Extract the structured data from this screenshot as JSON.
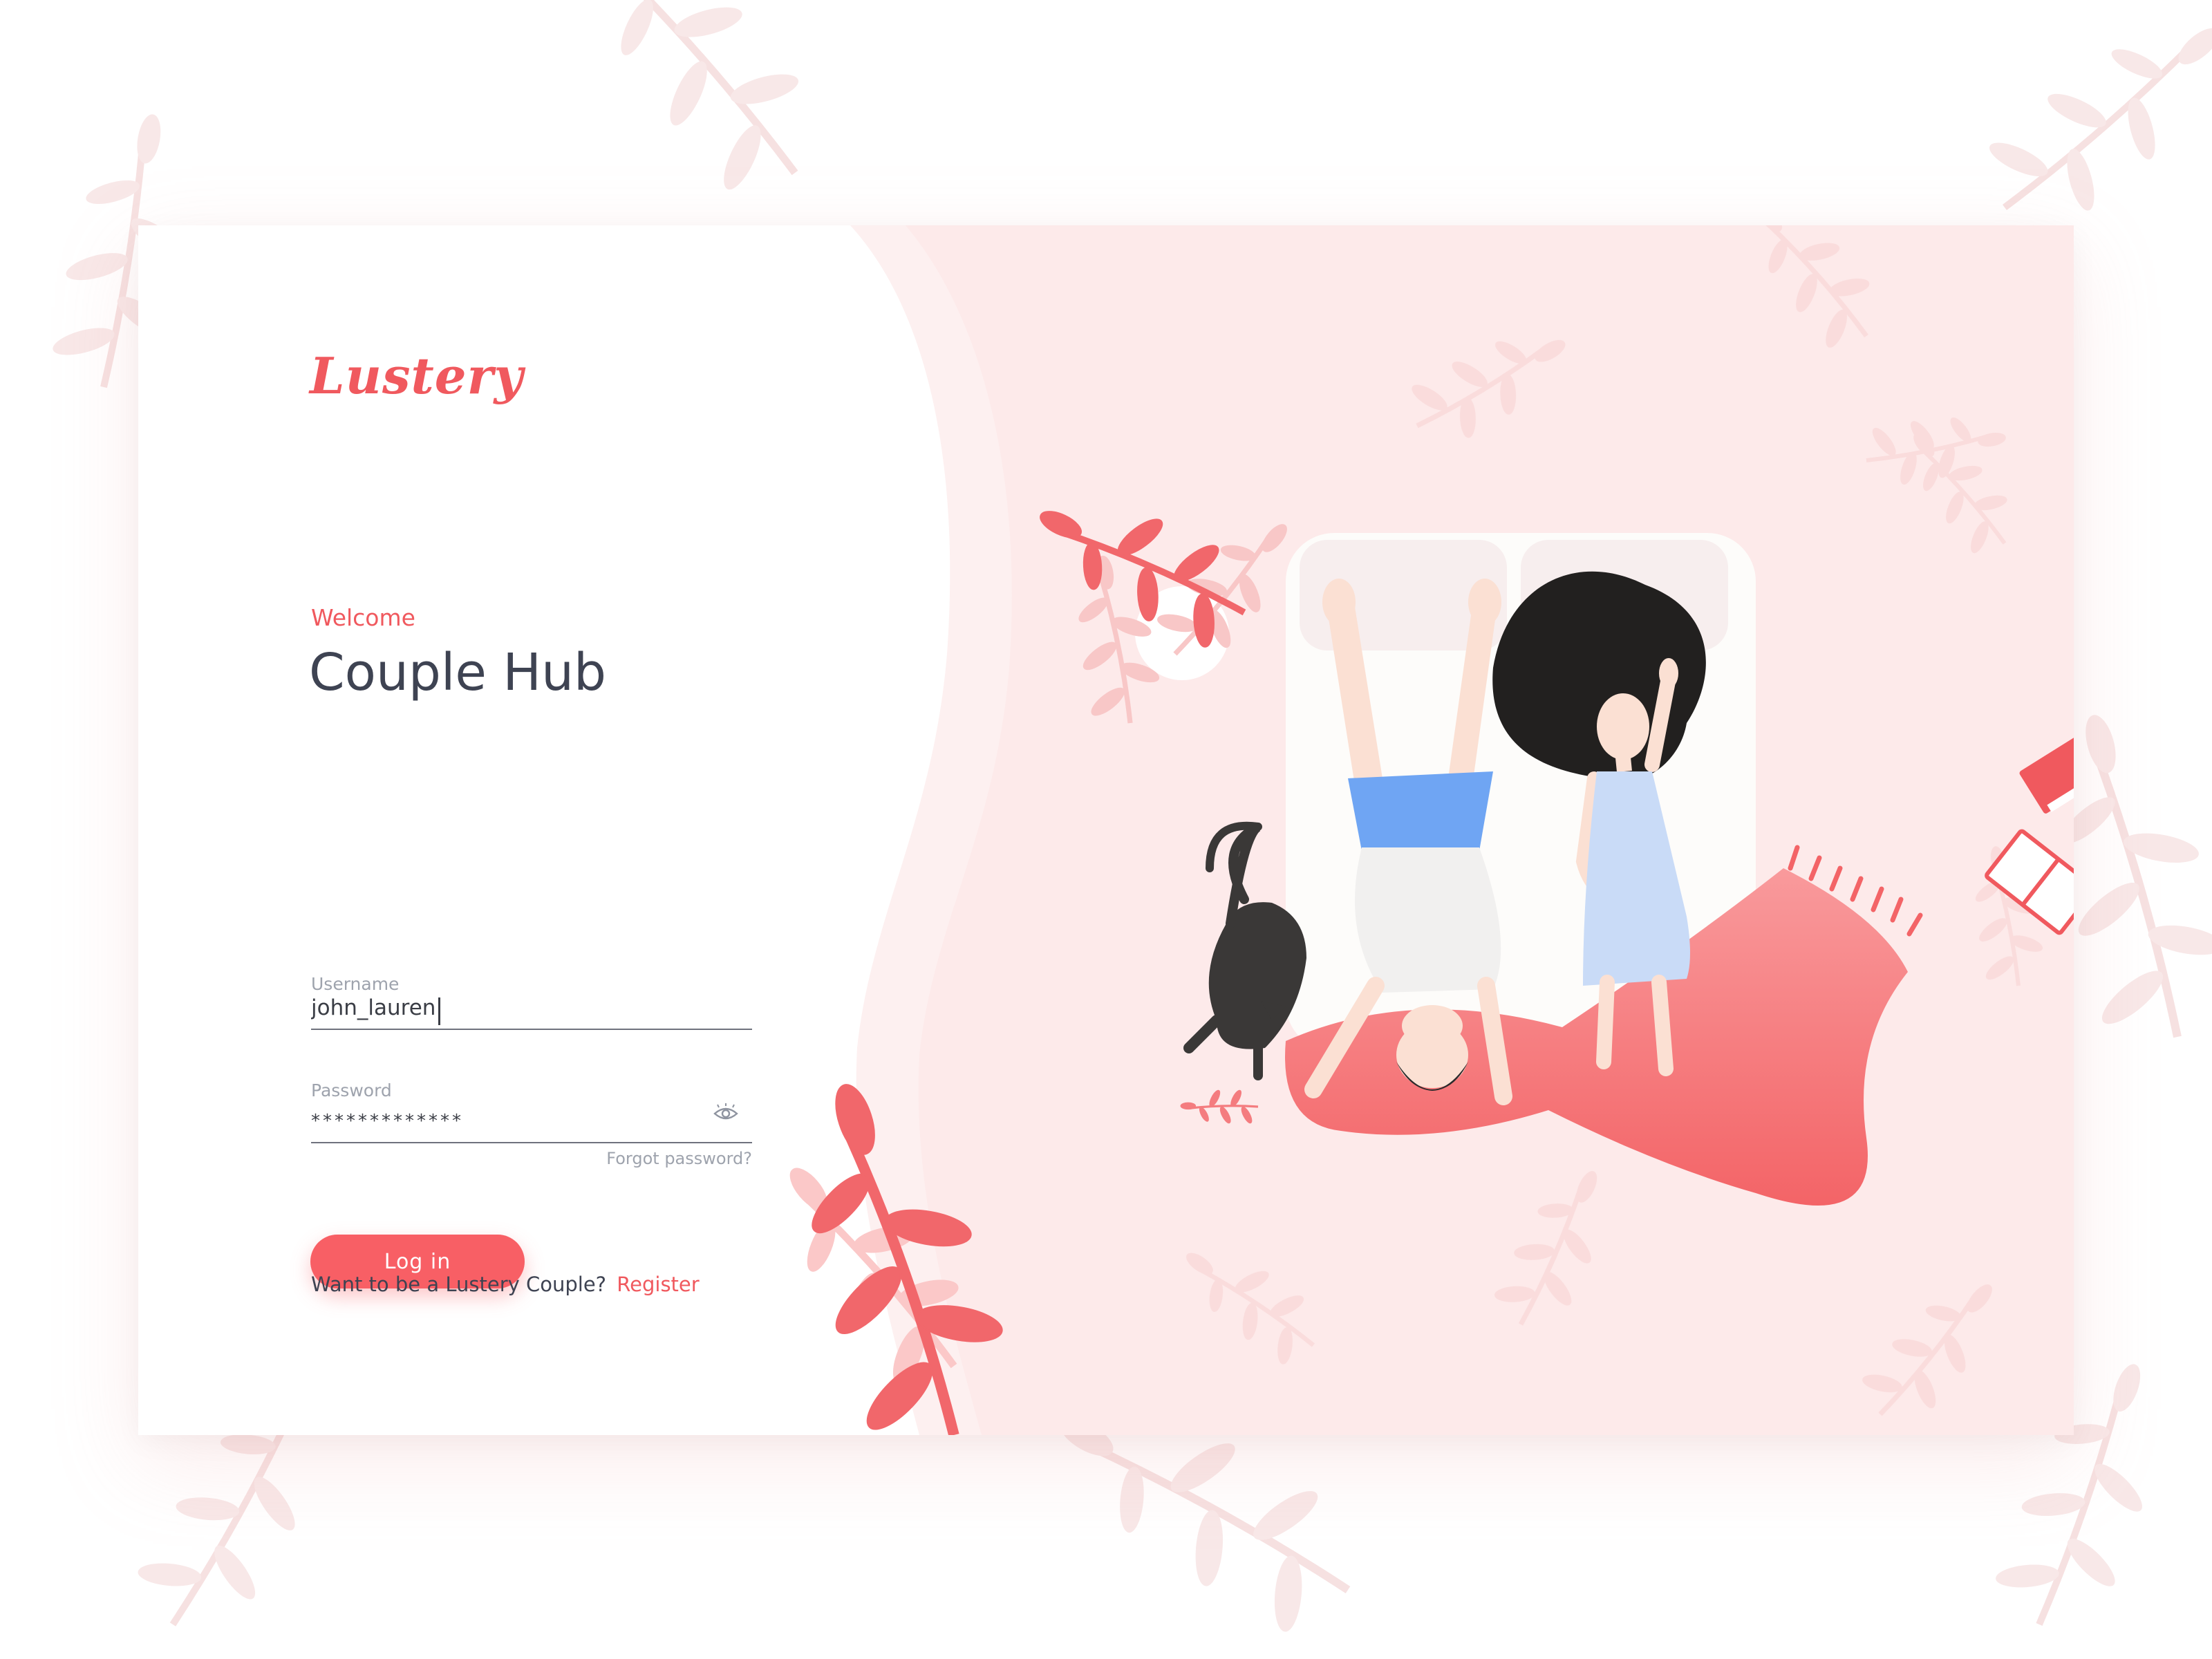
{
  "brand": {
    "logo_text": "Lustery",
    "accent_color": "#f0595e",
    "illustration_bg": "#fdeaea"
  },
  "login": {
    "welcome": "Welcome",
    "title": "Couple Hub",
    "username": {
      "label": "Username",
      "value": "john_lauren"
    },
    "password": {
      "label": "Password",
      "value": "*************",
      "toggle_icon": "eye-icon"
    },
    "forgot_password": "Forgot password?",
    "login_button": "Log in"
  },
  "footer": {
    "prompt": "Want to be a Lustery Couple?",
    "register_link": "Register"
  },
  "illustration": {
    "elements": [
      "bed-with-couple",
      "black-cat",
      "red-blanket",
      "plant-leaves",
      "books"
    ]
  }
}
